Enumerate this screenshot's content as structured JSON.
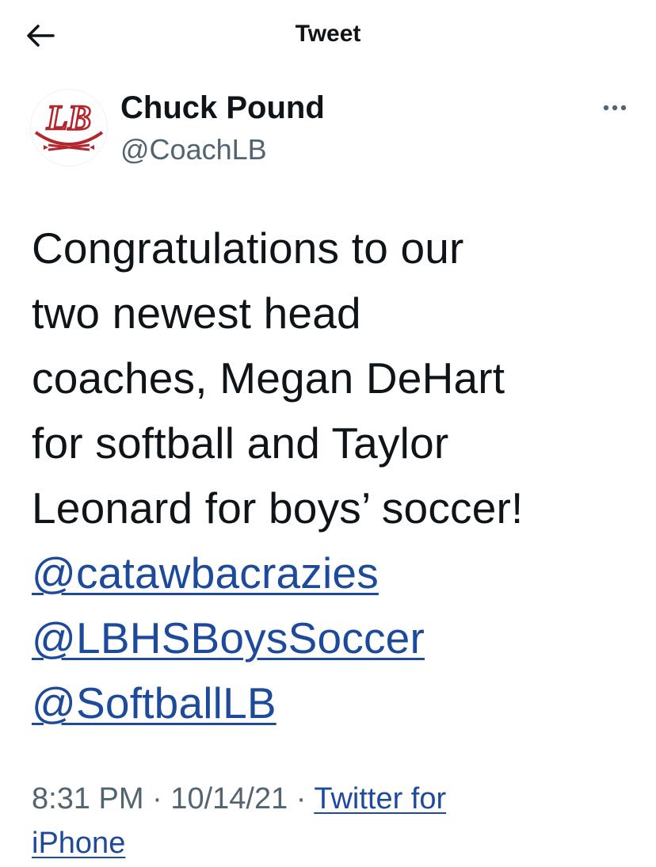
{
  "header": {
    "title": "Tweet",
    "back_icon": "back-arrow-icon"
  },
  "author": {
    "display_name": "Chuck Pound",
    "handle": "@CoachLB",
    "avatar": {
      "logo_text": "LB",
      "logo_color": "#b3262e"
    },
    "more_icon": "more-options-icon"
  },
  "tweet": {
    "lines": [
      "Congratulations to our",
      "two newest head",
      "coaches, Megan DeHart",
      "for softball and Taylor",
      "Leonard for boys’ soccer!"
    ],
    "mentions": [
      "@catawbacrazies",
      "@LBHSBoysSoccer",
      "@SoftballLB"
    ]
  },
  "meta": {
    "time": "8:31 PM",
    "separator": " · ",
    "date": "10/14/21",
    "source_line1": "Twitter for",
    "source_line2": "iPhone"
  },
  "colors": {
    "text": "#0f1419",
    "secondary": "#536471",
    "link": "#1d4a9a",
    "brand_red": "#b3262e"
  }
}
